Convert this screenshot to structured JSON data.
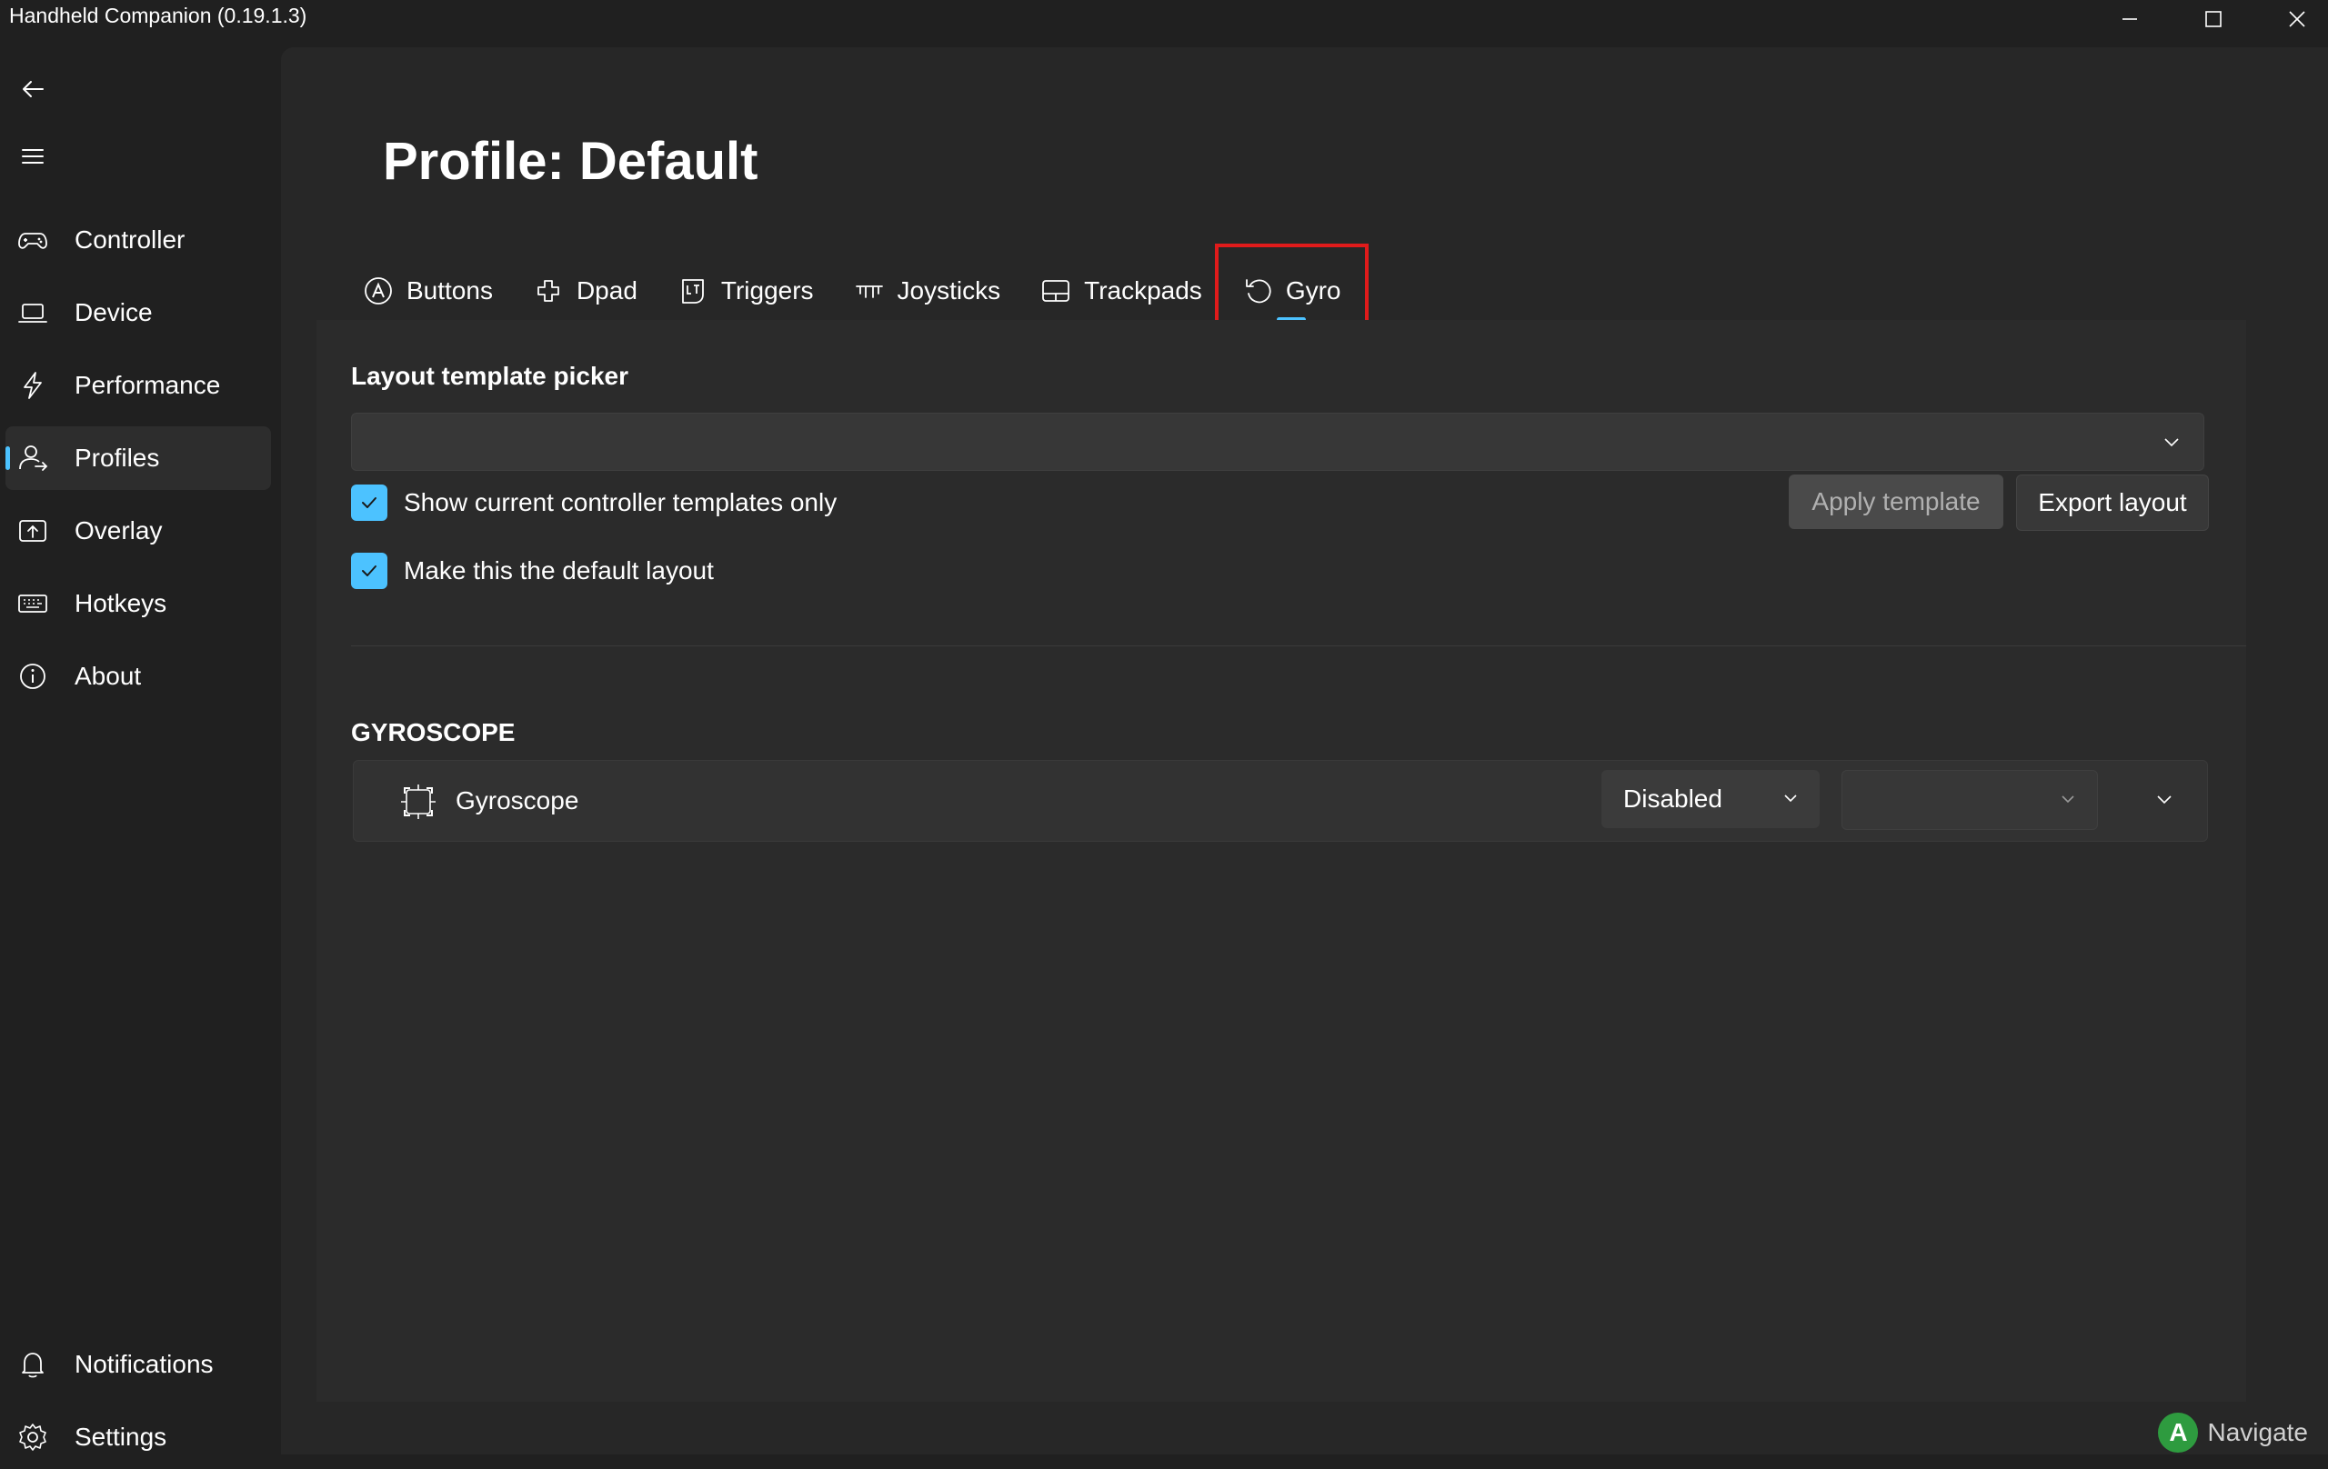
{
  "window": {
    "title": "Handheld Companion (0.19.1.3)",
    "controls": [
      "minimize-icon",
      "maximize-icon",
      "close-icon"
    ]
  },
  "sidebar": {
    "back_icon": "back-arrow-icon",
    "menu_icon": "hamburger-icon",
    "items": [
      {
        "label": "Controller",
        "icon": "gamepad-icon"
      },
      {
        "label": "Device",
        "icon": "laptop-icon"
      },
      {
        "label": "Performance",
        "icon": "lightning-icon"
      },
      {
        "label": "Profiles",
        "icon": "profiles-icon",
        "active": true
      },
      {
        "label": "Overlay",
        "icon": "overlay-icon"
      },
      {
        "label": "Hotkeys",
        "icon": "keyboard-icon"
      },
      {
        "label": "About",
        "icon": "info-icon"
      }
    ],
    "footer_items": [
      {
        "label": "Notifications",
        "icon": "bell-icon"
      },
      {
        "label": "Settings",
        "icon": "gear-icon"
      }
    ]
  },
  "page": {
    "title": "Profile: Default",
    "tabs": [
      {
        "label": "Buttons",
        "icon": "a-button-icon"
      },
      {
        "label": "Dpad",
        "icon": "dpad-icon"
      },
      {
        "label": "Triggers",
        "icon": "trigger-icon"
      },
      {
        "label": "Joysticks",
        "icon": "joystick-icon"
      },
      {
        "label": "Trackpads",
        "icon": "trackpad-icon"
      },
      {
        "label": "Gyro",
        "icon": "gyro-icon",
        "selected": true
      }
    ]
  },
  "template": {
    "heading": "Layout template picker",
    "picker_value": "",
    "show_current_only_label": "Show current controller templates only",
    "show_current_only_checked": true,
    "default_layout_label": "Make this the default layout",
    "default_layout_checked": true,
    "apply_label": "Apply template",
    "export_label": "Export layout"
  },
  "gyroscope": {
    "heading": "GYROSCOPE",
    "row_label": "Gyroscope",
    "row_icon": "gyroscope-icon",
    "mode_value": "Disabled",
    "secondary_value": ""
  },
  "footer": {
    "hint_button": "A",
    "hint_label": "Navigate"
  },
  "colors": {
    "accent": "#4cc2ff",
    "highlight_border": "#e01b1b",
    "background": "#202020",
    "panel": "#2b2b2b"
  }
}
